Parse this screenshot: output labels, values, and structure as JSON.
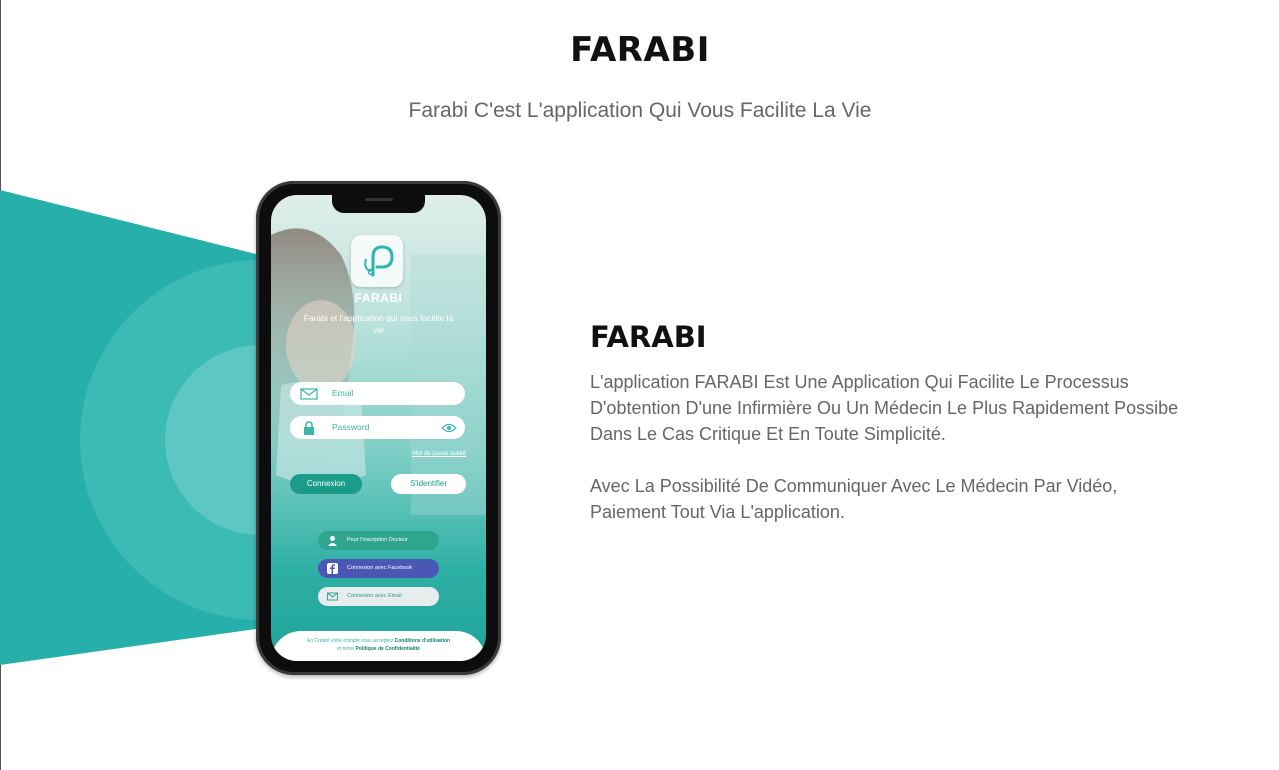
{
  "header": {
    "title": "FARABI",
    "subtitle": "Farabi C'est L'application Qui Vous Facilite La Vie"
  },
  "phone": {
    "app_name": "FARABI",
    "tagline": "Farabi et l'application qui vous facilite la vie",
    "email_placeholder": "Email",
    "password_placeholder": "Password",
    "forgot_password": "Mot de passe oublié",
    "login_button": "Connexion",
    "signup_button": "S'identifier",
    "social": [
      {
        "label": "Pour l'inscription Docteur",
        "color": "#2fa58f",
        "icon": "doctor-icon"
      },
      {
        "label": "Connexion avec Facebook",
        "color": "#4a57b4",
        "icon": "facebook-icon"
      },
      {
        "label": "Connexion avec Email",
        "color": "#e8ecec",
        "icon": "mail-icon"
      }
    ],
    "legal_prefix": "En Créant votre compte vous acceptez",
    "legal_terms": "Conditions d'utilisation",
    "legal_mid": "et notre",
    "legal_privacy": "Politique de Confidentialité"
  },
  "section": {
    "heading": "FARABI",
    "paragraph1": "L'application FARABI Est Une Application Qui Facilite Le Processus D'obtention D'une Infirmière Ou Un Médecin Le Plus Rapidement Possibe Dans Le Cas Critique Et En  Toute Simplicité.",
    "paragraph2": "Avec La Possibilité De Communiquer Avec Le Médecin Par Vidéo, Paiement Tout Via L'application."
  },
  "colors": {
    "accent": "#2bb6b0",
    "text_dark": "#111111",
    "text_muted": "#666666"
  }
}
